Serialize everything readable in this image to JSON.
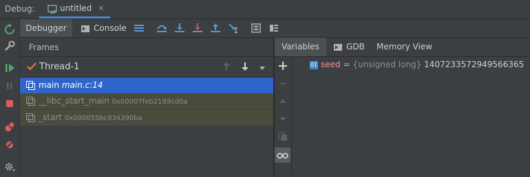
{
  "topbar": {
    "debug_label": "Debug:",
    "tab_label": "untitled"
  },
  "subbar": {
    "debugger_label": "Debugger",
    "console_label": "Console"
  },
  "frames": {
    "title": "Frames",
    "thread": "Thread-1",
    "items": [
      {
        "func": "main",
        "loc": "main.c:14"
      },
      {
        "func": "__libc_start_main",
        "loc": "0x00007feb2189cd0a"
      },
      {
        "func": "_start",
        "loc": "0x000055bc934390ba"
      }
    ]
  },
  "variables": {
    "tabs": {
      "variables": "Variables",
      "gdb": "GDB",
      "memory": "Memory View"
    },
    "badge": "01",
    "name": "seed",
    "eq": " = ",
    "type": "{unsigned long}",
    "value": "14072335729495663​65"
  },
  "colors": {
    "accent": "#4a88c7",
    "selection": "#2f65ca",
    "var_name": "#f98e8e"
  }
}
